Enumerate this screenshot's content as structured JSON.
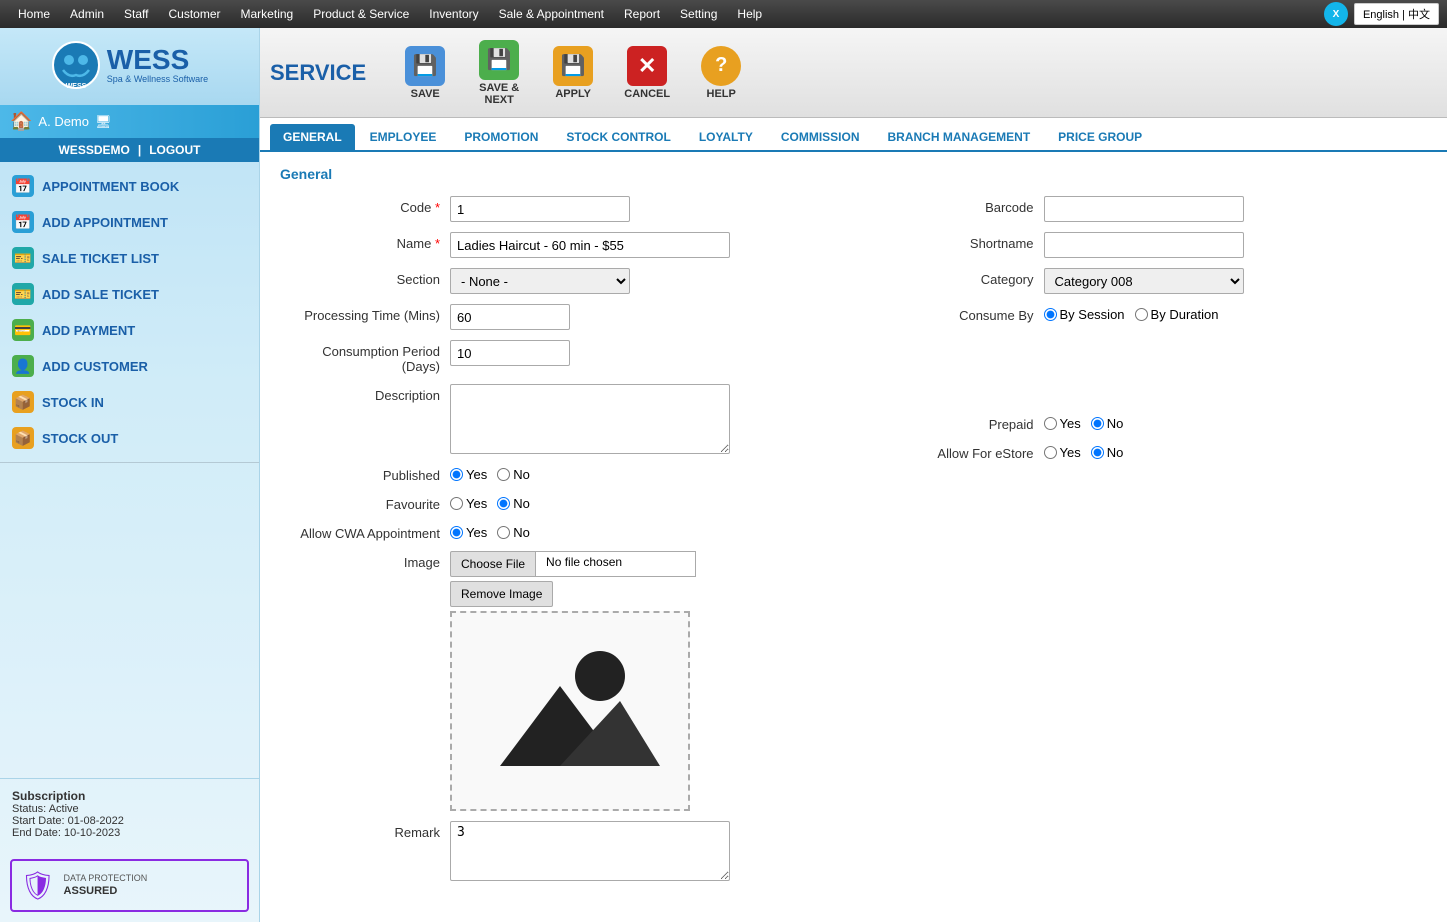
{
  "topnav": {
    "items": [
      "Home",
      "Admin",
      "Staff",
      "Customer",
      "Marketing",
      "Product & Service",
      "Inventory",
      "Sale & Appointment",
      "Report",
      "Setting",
      "Help"
    ],
    "xero_label": "X",
    "lang_label": "English | 中文"
  },
  "sidebar": {
    "logo_text": "WESS",
    "logo_tagline": "Spa & Wellness Software",
    "user": "A. Demo",
    "username": "WESSDEMO",
    "logout": "LOGOUT",
    "separator": "|",
    "menu": [
      {
        "label": "APPOINTMENT BOOK",
        "icon": "📅",
        "style": "icon-blue"
      },
      {
        "label": "ADD APPOINTMENT",
        "icon": "📅",
        "style": "icon-blue"
      },
      {
        "label": "SALE TICKET LIST",
        "icon": "🎫",
        "style": "icon-teal"
      },
      {
        "label": "ADD SALE TICKET",
        "icon": "🎫",
        "style": "icon-teal"
      },
      {
        "label": "ADD PAYMENT",
        "icon": "💳",
        "style": "icon-green"
      },
      {
        "label": "ADD CUSTOMER",
        "icon": "👤",
        "style": "icon-green"
      },
      {
        "label": "STOCK IN",
        "icon": "📦",
        "style": "icon-orange"
      },
      {
        "label": "STOCK OUT",
        "icon": "📦",
        "style": "icon-orange"
      }
    ],
    "subscription": {
      "title": "Subscription",
      "status": "Status: Active",
      "start": "Start Date: 01-08-2022",
      "end": "End Date: 10-10-2023"
    },
    "dpa": {
      "line1": "DATA PROTECTION",
      "line2": "ASSURED"
    }
  },
  "toolbar": {
    "title": "SERVICE",
    "buttons": [
      {
        "label": "SAVE",
        "icon": "💾",
        "style": "btn-save-icon"
      },
      {
        "label": "SAVE & NEXT",
        "icon": "💾",
        "style": "btn-savenext-icon"
      },
      {
        "label": "APPLY",
        "icon": "💾",
        "style": "btn-apply-icon"
      },
      {
        "label": "CANCEL",
        "icon": "✕",
        "style": "btn-cancel-icon"
      },
      {
        "label": "HELP",
        "icon": "?",
        "style": "btn-help-icon"
      }
    ]
  },
  "tabs": [
    {
      "label": "GENERAL",
      "active": true
    },
    {
      "label": "EMPLOYEE",
      "active": false
    },
    {
      "label": "PROMOTION",
      "active": false
    },
    {
      "label": "STOCK CONTROL",
      "active": false
    },
    {
      "label": "LOYALTY",
      "active": false
    },
    {
      "label": "COMMISSION",
      "active": false
    },
    {
      "label": "BRANCH MANAGEMENT",
      "active": false
    },
    {
      "label": "PRICE GROUP",
      "active": false
    }
  ],
  "form": {
    "section_title": "General",
    "code_label": "Code",
    "code_value": "1",
    "barcode_label": "Barcode",
    "barcode_value": "",
    "name_label": "Name",
    "name_value": "Ladies Haircut - 60 min - $55",
    "shortname_label": "Shortname",
    "shortname_value": "",
    "section_field_label": "Section",
    "section_value": "- None -",
    "section_options": [
      "- None -"
    ],
    "category_label": "Category",
    "category_value": "Category 008",
    "category_options": [
      "Category 008"
    ],
    "processing_time_label": "Processing Time (Mins)",
    "processing_time_value": "60",
    "consumption_period_label": "Consumption Period (Days)",
    "consumption_period_value": "10",
    "consume_by_label": "Consume By",
    "consume_by_session": "By Session",
    "consume_by_duration": "By Duration",
    "consume_by_selected": "session",
    "description_label": "Description",
    "description_value": "",
    "published_label": "Published",
    "published_yes": "Yes",
    "published_no": "No",
    "published_selected": "yes",
    "prepaid_label": "Prepaid",
    "prepaid_yes": "Yes",
    "prepaid_no": "No",
    "prepaid_selected": "no",
    "favourite_label": "Favourite",
    "favourite_yes": "Yes",
    "favourite_no": "No",
    "favourite_selected": "no",
    "allow_cwa_label": "Allow CWA Appointment",
    "allow_cwa_yes": "Yes",
    "allow_cwa_no": "No",
    "allow_cwa_selected": "yes",
    "allow_estore_label": "Allow For eStore",
    "allow_estore_yes": "Yes",
    "allow_estore_no": "No",
    "allow_estore_selected": "no",
    "image_label": "Image",
    "choose_file_label": "Choose File",
    "no_file_label": "No file chosen",
    "remove_image_label": "Remove Image",
    "remark_label": "Remark",
    "remark_value": "3"
  }
}
